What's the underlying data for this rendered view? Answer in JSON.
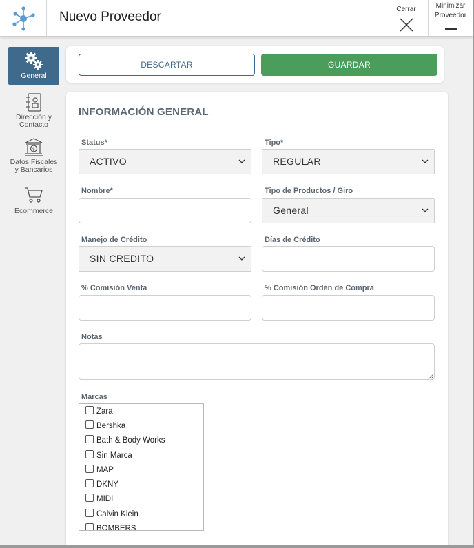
{
  "header": {
    "title": "Nuevo Proveedor",
    "close_label": "Cerrar",
    "minimize_label_line1": "Minimizar",
    "minimize_label_line2": "Proveedor"
  },
  "sidebar": {
    "items": [
      {
        "label": "General",
        "icon": "gears-icon",
        "active": true
      },
      {
        "label_line1": "Dirección y",
        "label_line2": "Contacto",
        "icon": "address-book-icon"
      },
      {
        "label_line1": "Datos Fiscales",
        "label_line2": "y Bancarios",
        "icon": "bank-icon"
      },
      {
        "label": "Ecommerce",
        "icon": "cart-icon"
      }
    ]
  },
  "actions": {
    "discard_label": "DESCARTAR",
    "save_label": "GUARDAR"
  },
  "form": {
    "section_title": "INFORMACIÓN GENERAL",
    "status": {
      "label": "Status*",
      "value": "ACTIVO"
    },
    "tipo": {
      "label": "Tipo*",
      "value": "REGULAR"
    },
    "nombre": {
      "label": "Nombre*",
      "value": ""
    },
    "tipo_productos": {
      "label": "Tipo de Productos / Giro",
      "value": "General"
    },
    "manejo_credito": {
      "label": "Manejo de Crédito",
      "value": "SIN CREDITO"
    },
    "dias_credito": {
      "label": "Días de Crédito",
      "value": ""
    },
    "comision_venta": {
      "label": "% Comisión Venta",
      "value": ""
    },
    "comision_orden": {
      "label": "% Comisión Orden de Compra",
      "value": ""
    },
    "notas": {
      "label": "Notas",
      "value": ""
    },
    "marcas": {
      "label": "Marcas",
      "items": [
        "Zara",
        "Bershka",
        "Bath & Body Works",
        "Sin Marca",
        "MAP",
        "DKNY",
        "MIDI",
        "Calvin Klein",
        "BOMBERS"
      ]
    }
  },
  "colors": {
    "accent": "#3f6a8c",
    "save": "#4a9d5a",
    "logo": "#5b9bd5"
  }
}
